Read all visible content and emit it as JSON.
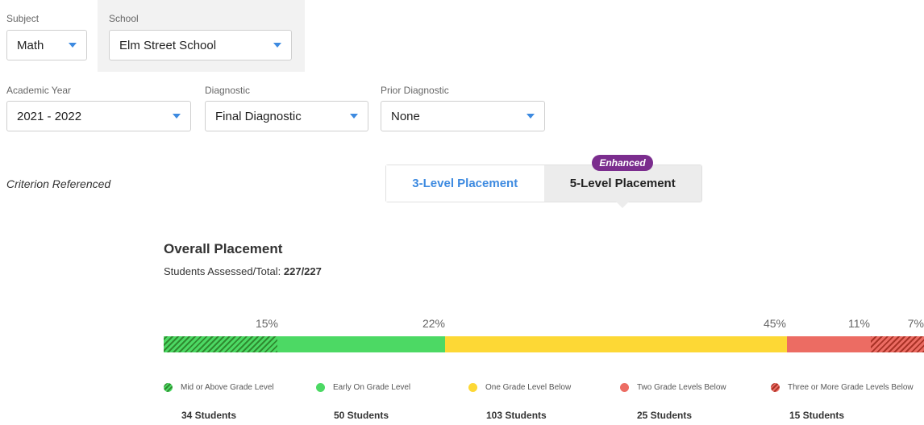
{
  "filters": {
    "subject": {
      "label": "Subject",
      "value": "Math"
    },
    "school": {
      "label": "School",
      "value": "Elm Street School"
    },
    "academic_year": {
      "label": "Academic Year",
      "value": "2021 - 2022"
    },
    "diagnostic": {
      "label": "Diagnostic",
      "value": "Final Diagnostic"
    },
    "prior_diagnostic": {
      "label": "Prior Diagnostic",
      "value": "None"
    }
  },
  "criterion": "Criterion Referenced",
  "toggle": {
    "badge": "Enhanced",
    "option_3": "3-Level Placement",
    "option_5": "5-Level Placement",
    "selected": "5-Level Placement"
  },
  "placement": {
    "title": "Overall Placement",
    "assessed_label": "Students Assessed/Total: ",
    "assessed_value": "227/227"
  },
  "colors": {
    "mid_or_above": "#2f8a2f",
    "early_on": "#4cd964",
    "one_below": "#fdd835",
    "two_below": "#ec6c63",
    "three_below": "#a93226",
    "accent": "#3d8ae0",
    "badge": "#7b2d8e"
  },
  "levels": [
    {
      "name": "Mid or Above Grade Level",
      "percent": 15,
      "percent_label": "15%",
      "count": "34 Students"
    },
    {
      "name": "Early On Grade Level",
      "percent": 22,
      "percent_label": "22%",
      "count": "50 Students"
    },
    {
      "name": "One Grade Level Below",
      "percent": 45,
      "percent_label": "45%",
      "count": "103 Students"
    },
    {
      "name": "Two Grade Levels Below",
      "percent": 11,
      "percent_label": "11%",
      "count": "25 Students"
    },
    {
      "name": "Three or More Grade Levels Below",
      "percent": 7,
      "percent_label": "7%",
      "count": "15 Students"
    }
  ]
}
